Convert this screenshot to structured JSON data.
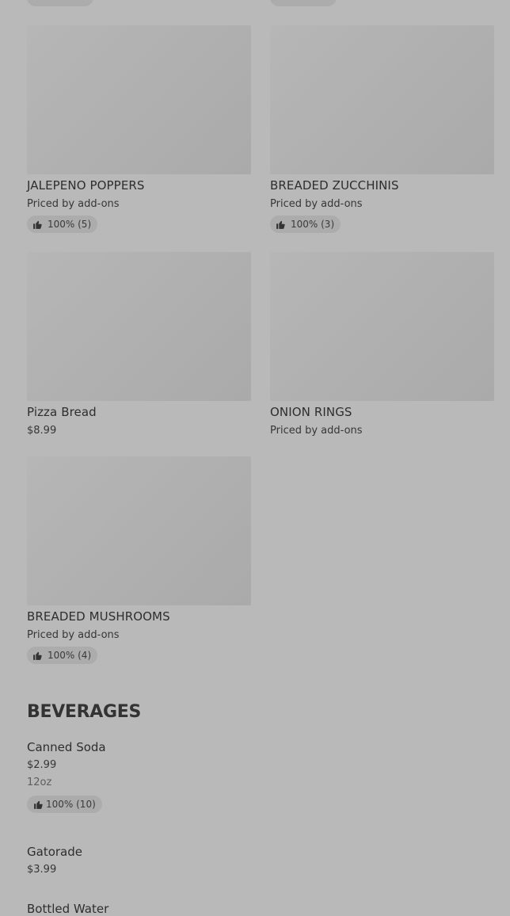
{
  "menu_items": [
    {
      "name": "JALEPENO POPPERS",
      "price": "Priced by add-ons",
      "rating": "100% (5)"
    },
    {
      "name": "BREADED ZUCCHINIS",
      "price": "Priced by add-ons",
      "rating": "100% (3)"
    },
    {
      "name": "Pizza Bread",
      "price": "$8.99"
    },
    {
      "name": "ONION RINGS",
      "price": "Priced by add-ons"
    },
    {
      "name": "BREADED MUSHROOMS",
      "price": "Priced by add-ons",
      "rating": "100% (4)"
    }
  ],
  "beverages": {
    "title": "BEVERAGES",
    "items": [
      {
        "name": "Canned Soda",
        "price": "$2.99",
        "description": "12oz",
        "rating": "100% (10)"
      },
      {
        "name": "Gatorade",
        "price": "$3.99"
      },
      {
        "name": "Bottled Water"
      }
    ]
  },
  "icons": {
    "rating": "thumbs-up-icon"
  },
  "colors": {
    "background": "#b9b9b9",
    "image_placeholder": "#b0b0b0",
    "pill": "#acacac",
    "text": "#2f2f2f"
  }
}
